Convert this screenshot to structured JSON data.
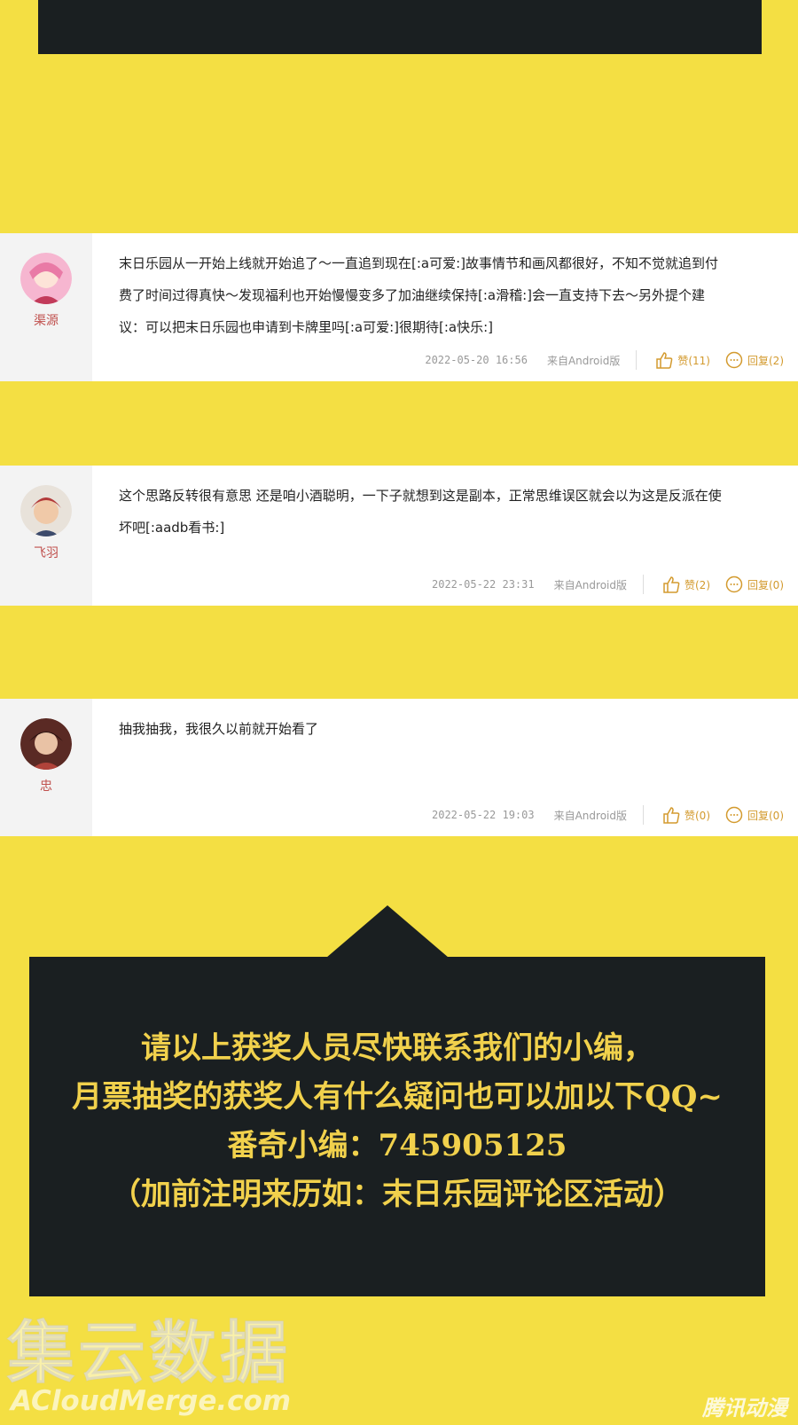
{
  "comments": [
    {
      "username": "渠源",
      "text_lines": [
        "末日乐园从一开始上线就开始追了～一直追到现在[:a可爱:]故事情节和画风都很好，不知不觉就追到付",
        "费了时间过得真快～发现福利也开始慢慢变多了加油继续保持[:a滑稽:]会一直支持下去～另外提个建",
        "议：可以把末日乐园也申请到卡牌里吗[:a可爱:]很期待[:a快乐:]"
      ],
      "date": "2022-05-20 16:56",
      "source": "来自Android版",
      "like": "赞(11)",
      "reply": "回复(2)",
      "avatar_colors": [
        "#f6b6d0",
        "#e97aa6"
      ]
    },
    {
      "username": "飞羽",
      "text_lines": [
        "这个思路反转很有意思 还是咱小酒聪明，一下子就想到这是副本，正常思维误区就会以为这是反派在使",
        "坏吧[:aadb看书:]"
      ],
      "date": "2022-05-22 23:31",
      "source": "来自Android版",
      "like": "赞(2)",
      "reply": "回复(0)",
      "avatar_colors": [
        "#f0c9a8",
        "#b23a3a"
      ]
    },
    {
      "username": "忠",
      "text_lines": [
        "抽我抽我，我很久以前就开始看了"
      ],
      "date": "2022-05-22 19:03",
      "source": "来自Android版",
      "like": "赞(0)",
      "reply": "回复(0)",
      "avatar_colors": [
        "#5a2a24",
        "#b0433a"
      ]
    }
  ],
  "notice": {
    "lines": [
      "请以上获奖人员尽快联系我们的小编，",
      "月票抽奖的获奖人有什么疑问也可以加以下QQ~",
      "番奇小编：745905125",
      "（加前注明来历如：末日乐园评论区活动）"
    ]
  },
  "watermarks": {
    "cn": "集云数据",
    "en": "ACloudMerge.com",
    "tx": "腾讯动漫"
  },
  "colors": {
    "background": "#f4df43",
    "dark_panel": "#1a1f21",
    "notice_text": "#f1d14c",
    "username": "#c0504d",
    "action": "#d39a2e"
  }
}
